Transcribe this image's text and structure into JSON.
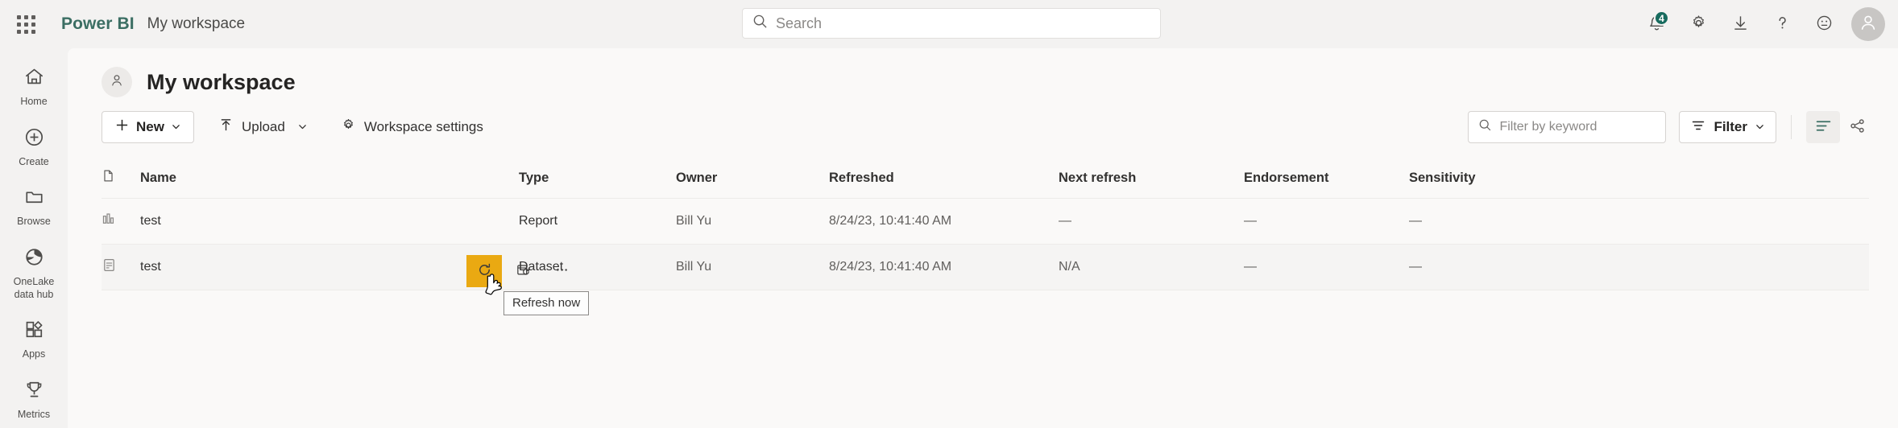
{
  "header": {
    "waffle_label": "app-launcher",
    "brand": "Power BI",
    "breadcrumb": "My workspace",
    "search": {
      "placeholder": "Search",
      "value": ""
    },
    "notifications": {
      "badge": "4"
    },
    "icons": {
      "notifications": "bell-icon",
      "settings": "gear-icon",
      "download": "download-icon",
      "help": "question-mark-icon",
      "feedback": "smiley-feedback-icon",
      "account": "user-avatar-icon"
    }
  },
  "sidebar": {
    "items": [
      {
        "label": "Home",
        "icon": "home-icon"
      },
      {
        "label": "Create",
        "icon": "plus-circle-icon"
      },
      {
        "label": "Browse",
        "icon": "folder-icon"
      },
      {
        "label": "OneLake\ndata hub",
        "label_line1": "OneLake",
        "label_line2": "data hub",
        "icon": "onelake-icon"
      },
      {
        "label": "Apps",
        "icon": "apps-grid-icon"
      },
      {
        "label": "Metrics",
        "icon": "trophy-icon"
      }
    ]
  },
  "workspace": {
    "title": "My workspace",
    "avatar_icon": "person-icon"
  },
  "commandbar": {
    "new_label": "New",
    "upload_label": "Upload",
    "settings_label": "Workspace settings",
    "filter_keyword": {
      "placeholder": "Filter by keyword",
      "value": ""
    },
    "filter_label": "Filter",
    "view_icon": "list-view-icon",
    "share_icon": "share-network-icon"
  },
  "table": {
    "columns": [
      {
        "key": "icon",
        "label": ""
      },
      {
        "key": "name",
        "label": "Name"
      },
      {
        "key": "type",
        "label": "Type"
      },
      {
        "key": "owner",
        "label": "Owner"
      },
      {
        "key": "refreshed",
        "label": "Refreshed"
      },
      {
        "key": "next_refresh",
        "label": "Next refresh"
      },
      {
        "key": "endorsement",
        "label": "Endorsement"
      },
      {
        "key": "sensitivity",
        "label": "Sensitivity"
      }
    ],
    "rows": [
      {
        "icon": "report-bar-chart-icon",
        "name": "test",
        "type": "Report",
        "owner": "Bill Yu",
        "refreshed": "8/24/23, 10:41:40 AM",
        "next_refresh": "—",
        "endorsement": "—",
        "sensitivity": "—"
      },
      {
        "icon": "dataset-table-icon",
        "name": "test",
        "type": "Dataset",
        "owner": "Bill Yu",
        "refreshed": "8/24/23, 10:41:40 AM",
        "next_refresh": "N/A",
        "endorsement": "—",
        "sensitivity": "—"
      }
    ]
  },
  "row_actions": {
    "refresh_now_icon": "refresh-circular-arrow-icon",
    "schedule_refresh_icon": "schedule-refresh-icon",
    "more_options_icon": "ellipsis-icon",
    "tooltip": "Refresh now",
    "highlight_color": "#eaa912"
  }
}
